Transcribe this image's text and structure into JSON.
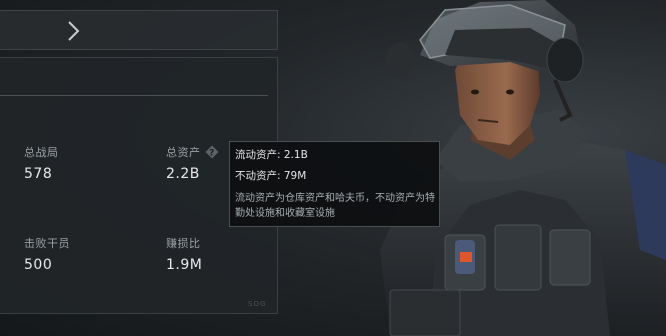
{
  "header": {
    "next_icon": "chevron-right-icon"
  },
  "stats": {
    "total_matches": {
      "label": "总战局",
      "value": "578"
    },
    "total_assets": {
      "label": "总资产",
      "value": "2.2B",
      "help_icon": "question-diamond-icon"
    },
    "defeated_operators": {
      "label": "击败干员",
      "value": "500"
    },
    "profit_ratio": {
      "label": "赚损比",
      "value": "1.9M"
    }
  },
  "watermark": {
    "text": "SOG"
  },
  "tooltip": {
    "liquid_assets": "流动资产: 2.1B",
    "fixed_assets": "不动资产: 79M",
    "description": "流动资产为仓库资产和哈夫币，不动资产为特勤处设施和收藏室设施"
  },
  "colors": {
    "panel_bg": "#212528",
    "tooltip_bg": "#0e1012",
    "text_primary": "#e8eaec",
    "text_secondary": "#9aa0a4",
    "accent_orange": "#e0562a"
  }
}
